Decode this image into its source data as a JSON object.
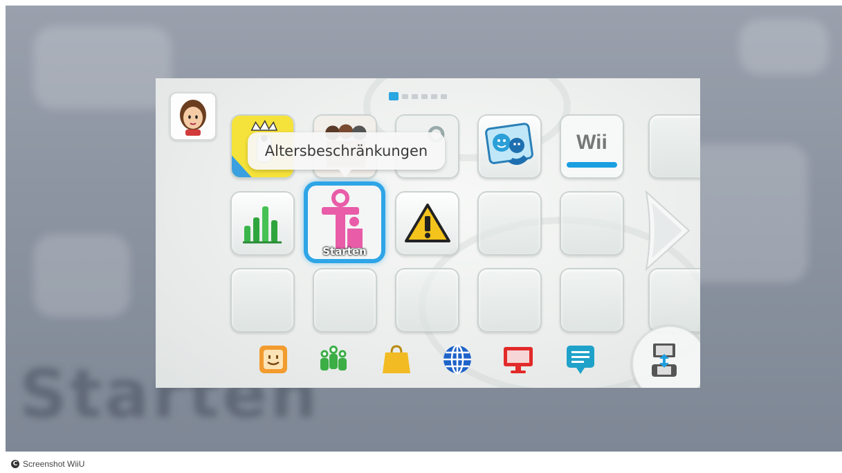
{
  "tooltip": {
    "text": "Altersbeschränkungen"
  },
  "selected_tile": {
    "label": "Starten"
  },
  "tiles_row1": [
    "Wii"
  ],
  "background_text": "Starten",
  "page_indicator": {
    "total": 6,
    "current": 1
  },
  "dock": [
    "miiverse-icon",
    "friends-icon",
    "eshop-icon",
    "browser-icon",
    "tvii-icon",
    "notifications-icon",
    "gamepad-transfer-icon"
  ],
  "caption": {
    "text": "Screenshot WiiU",
    "icon": "C"
  },
  "colors": {
    "accent": "#2ea5e6",
    "pink": "#e85ca8"
  }
}
